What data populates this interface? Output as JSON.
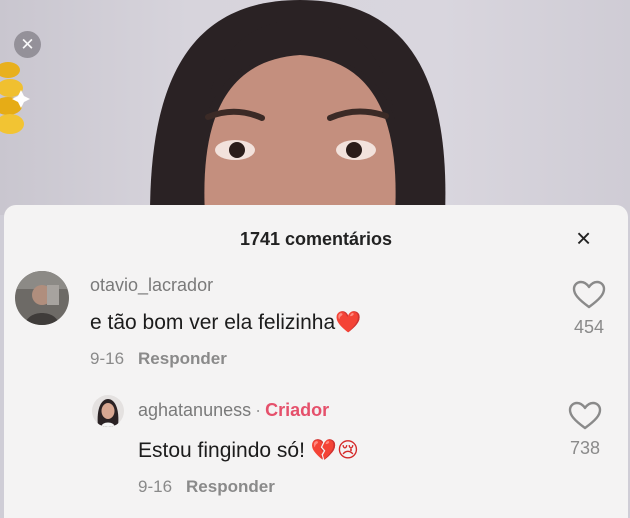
{
  "header": {
    "comment_count": "1741 comentários",
    "close_glyph": "×"
  },
  "video": {
    "close_glyph": "✕"
  },
  "comments": [
    {
      "username": "otavio_lacrador",
      "text": "e tão bom ver ela felizinha",
      "emoji": "❤️",
      "date": "9-16",
      "reply_label": "Responder",
      "likes": "454"
    }
  ],
  "replies": [
    {
      "username": "aghatanuness",
      "separator": "·",
      "badge": "Criador",
      "text": "Estou fingindo só!",
      "emoji": "💔😢",
      "date": "9-16",
      "reply_label": "Responder",
      "likes": "738"
    }
  ],
  "colors": {
    "sheet_bg": "#f4f3f3",
    "creator_badge": "#e5506b",
    "heart_emoji": "#e8262d",
    "muted_text": "#8a8a8a"
  },
  "icons": [
    "close-icon",
    "heart-outline-icon",
    "coin-stack-icon",
    "broken-heart-emoji",
    "crying-face-emoji"
  ]
}
